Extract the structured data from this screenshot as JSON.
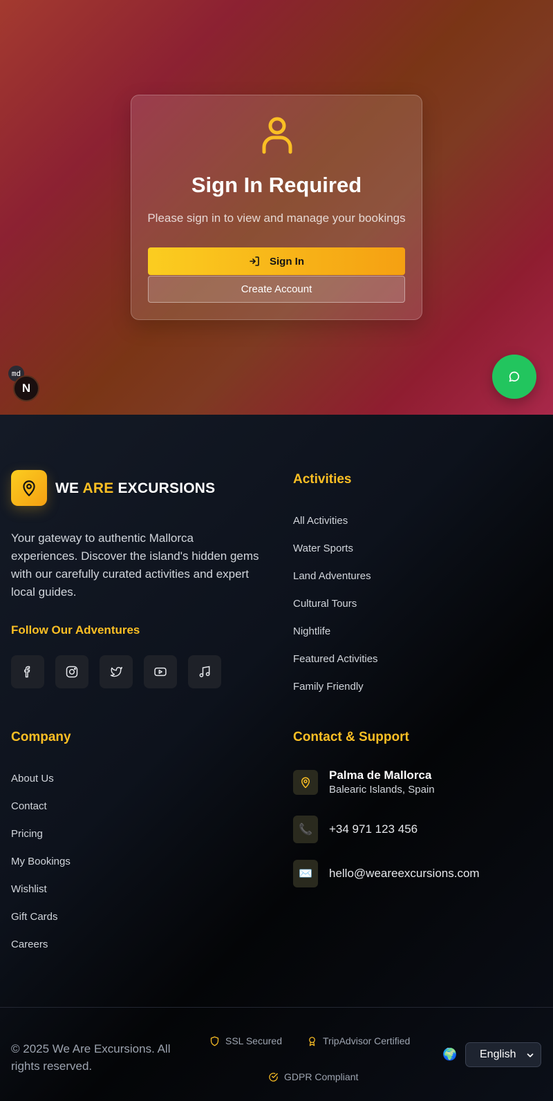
{
  "auth": {
    "title": "Sign In Required",
    "subtitle": "Please sign in to view and manage your bookings",
    "signin_label": "Sign In",
    "create_label": "Create Account"
  },
  "dev": {
    "md_badge": "md",
    "next_badge": "N"
  },
  "brand": {
    "part1": "WE ",
    "part2": "ARE",
    "part3": " EXCURSIONS"
  },
  "about_text": "Your gateway to authentic Mallorca experiences. Discover the island's hidden gems with our carefully curated activities and expert local guides.",
  "follow_title": "Follow Our Adventures",
  "socials": [
    "facebook-icon",
    "instagram-icon",
    "twitter-icon",
    "youtube-icon",
    "music-icon"
  ],
  "activities": {
    "title": "Activities",
    "links": [
      "All Activities",
      "Water Sports",
      "Land Adventures",
      "Cultural Tours",
      "Nightlife",
      "Featured Activities",
      "Family Friendly"
    ]
  },
  "company": {
    "title": "Company",
    "links": [
      "About Us",
      "Contact",
      "Pricing",
      "My Bookings",
      "Wishlist",
      "Gift Cards",
      "Careers"
    ]
  },
  "contact": {
    "title": "Contact & Support",
    "location_title": "Palma de Mallorca",
    "location_sub": "Balearic Islands, Spain",
    "phone": "+34 971 123 456",
    "email": "hello@weareexcursions.com"
  },
  "bottom": {
    "copyright": "© 2025 We Are Excursions. All rights reserved.",
    "badges": [
      "SSL Secured",
      "TripAdvisor Certified",
      "GDPR Compliant"
    ],
    "language": "English"
  },
  "colors": {
    "accent": "#fbbf24",
    "chat": "#22c55e"
  }
}
